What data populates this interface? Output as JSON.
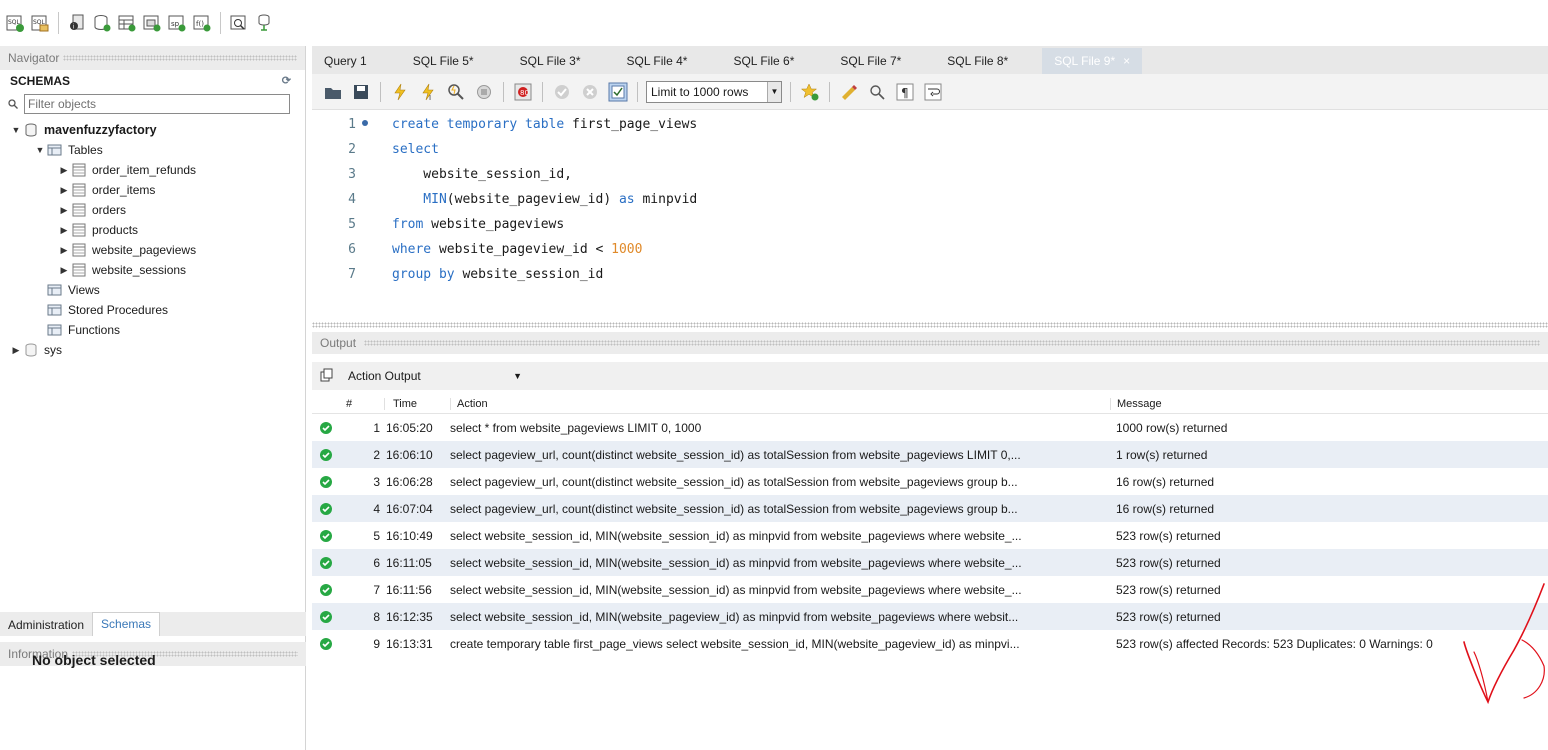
{
  "top_toolbar": {
    "icons": [
      "new-sql-tab-icon",
      "open-sql-script-icon",
      "inspector-icon",
      "create-schema-icon",
      "create-table-icon",
      "create-view-icon",
      "create-procedure-icon",
      "create-function-icon",
      "search-table-data-icon",
      "reconnect-icon"
    ]
  },
  "navigator": {
    "header": "Navigator",
    "schemas_title": "SCHEMAS",
    "filter_placeholder": "Filter objects",
    "tree": {
      "db_name": "mavenfuzzyfactory",
      "tables_label": "Tables",
      "tables": [
        "order_item_refunds",
        "order_items",
        "orders",
        "products",
        "website_pageviews",
        "website_sessions"
      ],
      "views_label": "Views",
      "procedures_label": "Stored Procedures",
      "functions_label": "Functions",
      "sys_label": "sys"
    }
  },
  "bottom_tabs": {
    "administration": "Administration",
    "schemas": "Schemas"
  },
  "information": {
    "header": "Information",
    "empty_text": "No object selected"
  },
  "editor_tabs": [
    {
      "label": "Query 1"
    },
    {
      "label": "SQL File 5*"
    },
    {
      "label": "SQL File 3*"
    },
    {
      "label": "SQL File 4*"
    },
    {
      "label": "SQL File 6*"
    },
    {
      "label": "SQL File 7*"
    },
    {
      "label": "SQL File 8*"
    },
    {
      "label": "SQL File 9*",
      "active": true
    }
  ],
  "editor_toolbar": {
    "limit_value": "Limit to 1000 rows"
  },
  "code": {
    "lines": [
      {
        "n": "1",
        "parts": [
          {
            "t": "create temporary table ",
            "c": "kw"
          },
          {
            "t": "first_page_views",
            "c": "plain"
          }
        ]
      },
      {
        "n": "2",
        "parts": [
          {
            "t": "select",
            "c": "kw"
          }
        ]
      },
      {
        "n": "3",
        "parts": [
          {
            "t": "    website_session_id,",
            "c": "plain"
          }
        ]
      },
      {
        "n": "4",
        "parts": [
          {
            "t": "    MIN",
            "c": "fn"
          },
          {
            "t": "(website_pageview_id) ",
            "c": "plain"
          },
          {
            "t": "as",
            "c": "kw"
          },
          {
            "t": " minpvid",
            "c": "plain"
          }
        ]
      },
      {
        "n": "5",
        "parts": [
          {
            "t": "from",
            "c": "kw"
          },
          {
            "t": " website_pageviews",
            "c": "plain"
          }
        ]
      },
      {
        "n": "6",
        "parts": [
          {
            "t": "where",
            "c": "kw"
          },
          {
            "t": " website_pageview_id < ",
            "c": "plain"
          },
          {
            "t": "1000",
            "c": "num"
          }
        ]
      },
      {
        "n": "7",
        "parts": [
          {
            "t": "group by",
            "c": "kw"
          },
          {
            "t": " website_session_id",
            "c": "plain"
          }
        ]
      }
    ]
  },
  "output": {
    "header": "Output",
    "selector_value": "Action Output",
    "columns": {
      "num": "#",
      "time": "Time",
      "action": "Action",
      "message": "Message"
    },
    "rows": [
      {
        "num": "1",
        "time": "16:05:20",
        "action": "select * from website_pageviews LIMIT 0, 1000",
        "message": "1000 row(s) returned"
      },
      {
        "num": "2",
        "time": "16:06:10",
        "action": "select  pageview_url,     count(distinct website_session_id) as totalSession from website_pageviews LIMIT 0,...",
        "message": "1 row(s) returned"
      },
      {
        "num": "3",
        "time": "16:06:28",
        "action": "select  pageview_url,     count(distinct website_session_id) as totalSession from website_pageviews group b...",
        "message": "16 row(s) returned"
      },
      {
        "num": "4",
        "time": "16:07:04",
        "action": "select  pageview_url,     count(distinct website_session_id) as totalSession from website_pageviews group b...",
        "message": "16 row(s) returned"
      },
      {
        "num": "5",
        "time": "16:10:49",
        "action": "select  website_session_id,     MIN(website_session_id) as minpvid from website_pageviews where website_...",
        "message": "523 row(s) returned"
      },
      {
        "num": "6",
        "time": "16:11:05",
        "action": "select  website_session_id,     MIN(website_session_id) as minpvid from website_pageviews where website_...",
        "message": "523 row(s) returned"
      },
      {
        "num": "7",
        "time": "16:11:56",
        "action": "select  website_session_id,     MIN(website_session_id) as minpvid from website_pageviews where website_...",
        "message": "523 row(s) returned"
      },
      {
        "num": "8",
        "time": "16:12:35",
        "action": "select  website_session_id,     MIN(website_pageview_id) as minpvid from website_pageviews where websit...",
        "message": "523 row(s) returned"
      },
      {
        "num": "9",
        "time": "16:13:31",
        "action": "create temporary table first_page_views select  website_session_id,     MIN(website_pageview_id) as minpvi...",
        "message": "523 row(s) affected Records: 523  Duplicates: 0  Warnings: 0"
      }
    ]
  },
  "colors": {
    "keyword": "#2a6fc4",
    "number": "#e08a2a",
    "success": "#27a844",
    "annotation": "#e0101a",
    "active_tab_link": "#3a78b8"
  }
}
